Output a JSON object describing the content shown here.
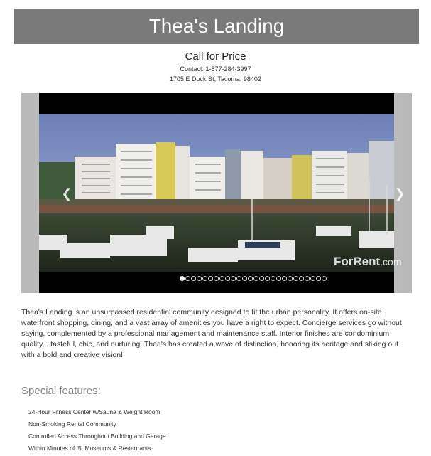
{
  "header": {
    "title": "Thea's Landing"
  },
  "listing": {
    "price": "Call for Price",
    "contact": "Contact: 1-877-284-3997",
    "address": "1705 E Dock St, Tacoma, 98402"
  },
  "gallery": {
    "prev_arrow": "❮",
    "next_arrow": "❯",
    "watermark_brand": "ForRent",
    "watermark_suffix": ".com",
    "slide_count": 26,
    "active_slide": 1
  },
  "description": "Thea's Landing is an unsurpassed residential community designed to fit the urban personality. It offers on-site waterfront shopping, dining, and a vast array of amenities you have a right to expect. Concierge services go without saying, complemented by a professional management and maintenance staff. Interior finishes are condominium quality... tasteful, chic, and nurturing. Thea's has created a wave of distinction, honoring its heritage and stiking out with a bold and creative vision!.",
  "features": {
    "heading": "Special features:",
    "items": [
      "24-Hour Fitness Center w/Sauna & Weight Room",
      "Non-Smoking Rental Community",
      "Controlled Access Throughout Building and Garage",
      "Within Minutes of I5, Museums & Restaurants"
    ]
  },
  "colors": {
    "title_bar": "#7a7a7a",
    "heading_gray": "#888888"
  }
}
